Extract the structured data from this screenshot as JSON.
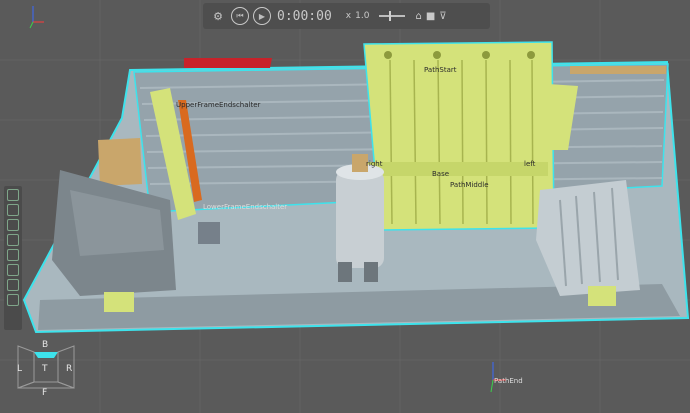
{
  "toolbar": {
    "settings_icon": "gear-icon",
    "rewind_icon": "skip-back-icon",
    "play_icon": "play-icon",
    "time": "0:00:00",
    "speed_prefix": "x",
    "speed": "1.0",
    "record_icon": "record-icon",
    "camera_icon": "camera-icon",
    "filter_icon": "filter-icon"
  },
  "palette": {
    "items": [
      "select-icon",
      "frame-icon",
      "view-icon",
      "layers-icon",
      "material-icon",
      "shape-icon",
      "transform-icon",
      "object-icon"
    ]
  },
  "navcube": {
    "top": "B",
    "left": "L",
    "center": "T",
    "right": "R",
    "bottom": "F"
  },
  "labels": {
    "upper": "UpperFrameEndschalter",
    "lower": "LowerFrameEndschalter",
    "path_start": "PathStart",
    "right": "right",
    "left": "left",
    "base": "Base",
    "path_middle": "PathMiddle",
    "path_end": "PathEnd"
  },
  "colors": {
    "background": "#5a5a5a",
    "frame": "#b8c4ca",
    "highlight": "#4fe0e8",
    "yellow_part": "#d4e27a",
    "red_part": "#c8222a",
    "orange_part": "#d96a1f",
    "tan_part": "#c9a66b"
  }
}
